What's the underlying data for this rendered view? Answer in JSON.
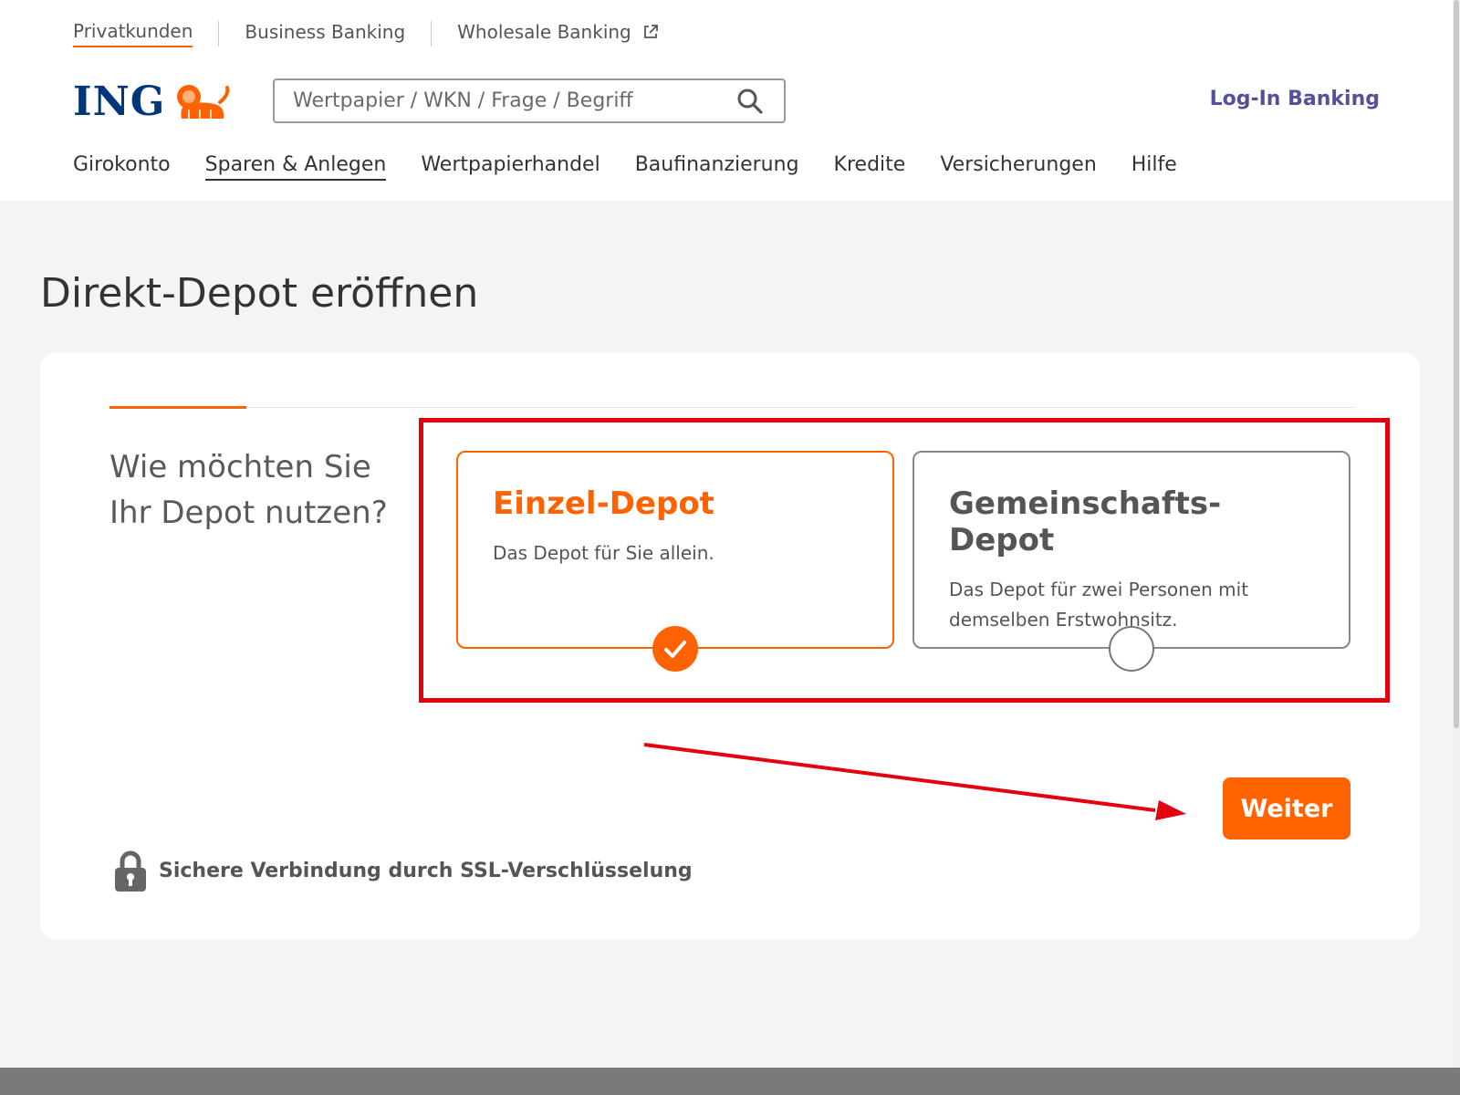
{
  "segments": {
    "privat": "Privatkunden",
    "business": "Business Banking",
    "wholesale": "Wholesale Banking"
  },
  "logo": {
    "text": "ING"
  },
  "search": {
    "placeholder": "Wertpapier / WKN / Frage / Begriff",
    "value": ""
  },
  "login": {
    "label": "Log-In Banking"
  },
  "main_nav": {
    "items": [
      {
        "label": "Girokonto"
      },
      {
        "label": "Sparen & Anlegen"
      },
      {
        "label": "Wertpapierhandel"
      },
      {
        "label": "Baufinanzierung"
      },
      {
        "label": "Kredite"
      },
      {
        "label": "Versicherungen"
      },
      {
        "label": "Hilfe"
      }
    ],
    "active_index": 1
  },
  "page": {
    "title": "Direkt-Depot eröffnen"
  },
  "form": {
    "question": "Wie möchten Sie Ihr Depot nutzen?",
    "options": [
      {
        "title": "Einzel-Depot",
        "description": "Das Depot für Sie allein.",
        "selected": true
      },
      {
        "title": "Gemeinschafts-Depot",
        "description": "Das Depot für zwei Personen mit demselben Erstwohnsitz.",
        "selected": false
      }
    ],
    "next_label": "Weiter",
    "security_note": "Sichere Verbindung durch SSL-Verschlüsselung"
  },
  "colors": {
    "accent": "#ff6200",
    "brand_blue": "#00377a",
    "login_link": "#525199",
    "annotation_red": "#e4000f"
  },
  "icons": [
    "external-link-icon",
    "lion-logo-icon",
    "search-icon",
    "checkmark-icon",
    "lock-icon"
  ]
}
